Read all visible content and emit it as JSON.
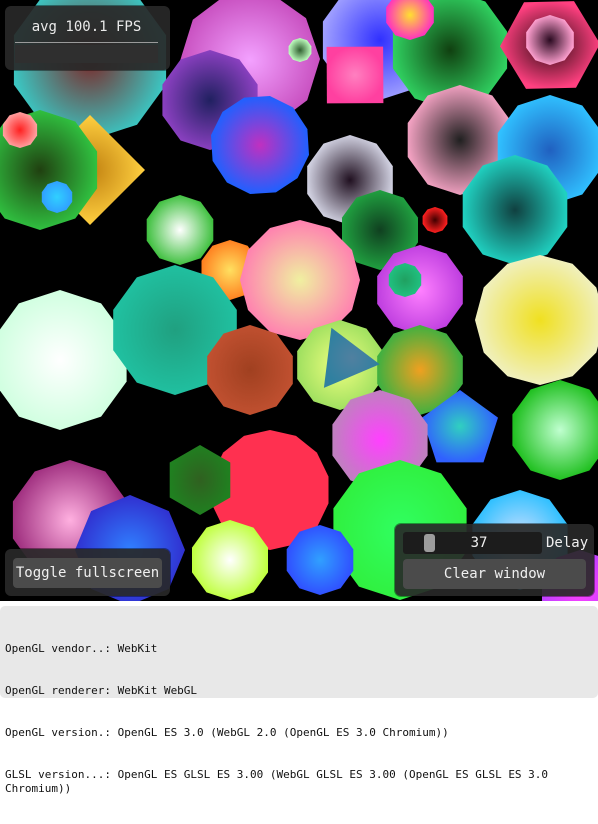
{
  "fps": {
    "label": "avg 100.1 FPS"
  },
  "controls": {
    "delay_value": "37 ms",
    "delay_label": "Delay",
    "delay_level_fraction": 0.15,
    "clear_label": "Clear window",
    "fullscreen_label": "Toggle fullscreen"
  },
  "info": {
    "lines": [
      "OpenGL vendor..: WebKit",
      "OpenGL renderer: WebKit WebGL",
      "OpenGL version.: OpenGL ES 3.0 (WebGL 2.0 (OpenGL ES 3.0 Chromium))",
      "GLSL version...: OpenGL ES GLSL ES 3.00 (WebGL GLSL ES 3.00 (OpenGL ES GLSL ES 3.0 Chromium))"
    ]
  },
  "colors": {
    "canvas_bg": "#000000",
    "panel_bg": "#282828",
    "button_bg": "#4b4b4b",
    "info_bg": "#e8e8e8"
  }
}
